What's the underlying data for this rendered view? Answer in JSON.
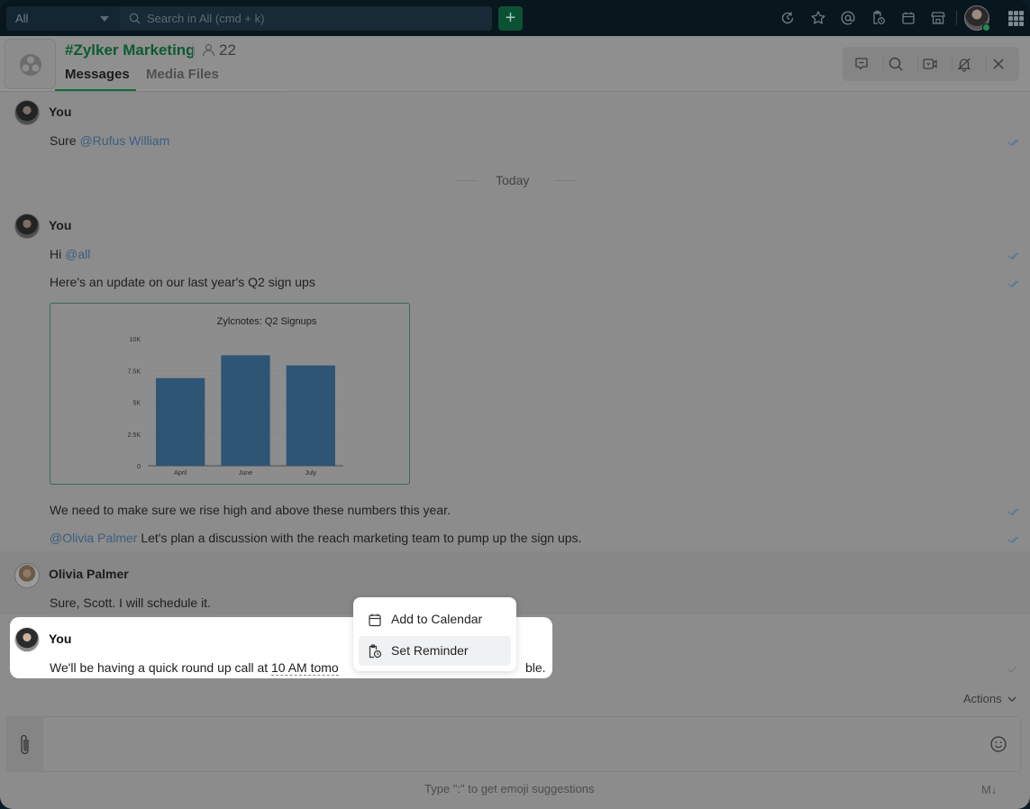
{
  "topbar": {
    "scope_label": "All",
    "search_placeholder": "Search in All (cmd + k)",
    "add_label": "+",
    "icons": [
      "history-icon",
      "star-icon",
      "mention-icon",
      "reminder-icon",
      "calendar-icon",
      "store-icon"
    ],
    "presence_color": "#1f8a4d"
  },
  "channel": {
    "title": "#Zylker Marketing",
    "member_count": "22",
    "tabs": [
      {
        "label": "Messages",
        "active": true
      },
      {
        "label": "Media Files",
        "active": false
      }
    ],
    "accent_color": "#0c6a3b"
  },
  "header_actions": [
    "thread-icon",
    "search-icon",
    "video-call-icon",
    "mute-notifications-icon",
    "close-icon"
  ],
  "messages": {
    "m1": {
      "sender": "You",
      "prefix": "Sure ",
      "mention": "@Rufus William"
    },
    "date_separator": "Today",
    "m2": {
      "sender": "You",
      "line1_prefix": "Hi ",
      "line1_mention": "@all",
      "line2": "Here's an update on our last year's Q2 sign ups",
      "line3": "We need to make sure we rise high and above these numbers this year.",
      "line4_mention": "@Olivia Palmer",
      "line4_text": " Let's plan a discussion with the reach marketing team to pump up the sign ups."
    },
    "m3": {
      "sender": "Olivia Palmer",
      "text": "Sure, Scott. I will schedule it."
    },
    "m4": {
      "sender": "You",
      "prefix": "We'll be having a quick round up call at ",
      "datetime": "10 AM tomo",
      "suffix": "ble."
    }
  },
  "context_menu": {
    "items": [
      {
        "label": "Add to Calendar",
        "icon": "calendar-icon"
      },
      {
        "label": "Set Reminder",
        "icon": "reminder-icon",
        "hovered": true
      }
    ]
  },
  "composer": {
    "actions_label": "Actions",
    "hint": "Type \":\" to get emoji suggestions",
    "markdown_label": "M↓"
  },
  "chart_data": {
    "type": "bar",
    "title": "Zylcnotes: Q2 Signups",
    "categories": [
      "April",
      "June",
      "July"
    ],
    "values": [
      6900,
      8700,
      7900
    ],
    "xlabel": "",
    "ylabel": "",
    "ylim": [
      0,
      10000
    ],
    "yticks": [
      0,
      2500,
      5000,
      7500,
      10000
    ],
    "ytick_labels": [
      "0",
      "2.5K",
      "5K",
      "7.5K",
      "10K"
    ],
    "grid": true,
    "bar_color": "#2f5574"
  }
}
